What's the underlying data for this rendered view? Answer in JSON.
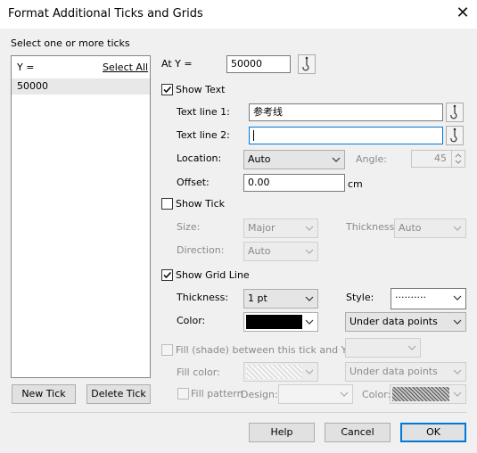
{
  "dialog": {
    "title": "Format Additional Ticks and Grids"
  },
  "ticks_panel": {
    "heading": "Select one or more ticks",
    "column_label": "Y =",
    "select_all_label": "Select All",
    "rows": [
      "50000"
    ],
    "new_tick_label": "New Tick",
    "delete_tick_label": "Delete Tick"
  },
  "at_y": {
    "label": "At Y =",
    "value": "50000"
  },
  "show_text": {
    "label": "Show Text",
    "checked": true,
    "text_line_1_label": "Text line 1:",
    "text_line_1_value": "参考线",
    "text_line_2_label": "Text line 2:",
    "text_line_2_value": "",
    "location_label": "Location:",
    "location_value": "Auto",
    "angle_label": "Angle:",
    "angle_value": "45",
    "offset_label": "Offset:",
    "offset_value": "0.00",
    "offset_unit": "cm"
  },
  "show_tick": {
    "label": "Show Tick",
    "checked": false,
    "size_label": "Size:",
    "size_value": "Major",
    "thickness_label": "Thickness:",
    "thickness_value": "Auto",
    "direction_label": "Direction:",
    "direction_value": "Auto"
  },
  "show_grid_line": {
    "label": "Show Grid Line",
    "checked": true,
    "thickness_label": "Thickness:",
    "thickness_value": "1 pt",
    "style_label": "Style:",
    "style_value": "··········",
    "color_label": "Color:",
    "color_value": "#000000",
    "layer_value": "Under data points"
  },
  "fill": {
    "label": "Fill (shade) between this tick and Y =",
    "checked": false,
    "fill_color_label": "Fill color:",
    "layer_value": "Under data points",
    "fill_pattern_label": "Fill pattern",
    "design_label": "Design:",
    "color_label": "Color:"
  },
  "buttons": {
    "help": "Help",
    "cancel": "Cancel",
    "ok": "OK"
  },
  "icons": {
    "close": "close-icon",
    "picker": "dropper-hook-icon",
    "dropdown": "chevron-down-icon"
  }
}
